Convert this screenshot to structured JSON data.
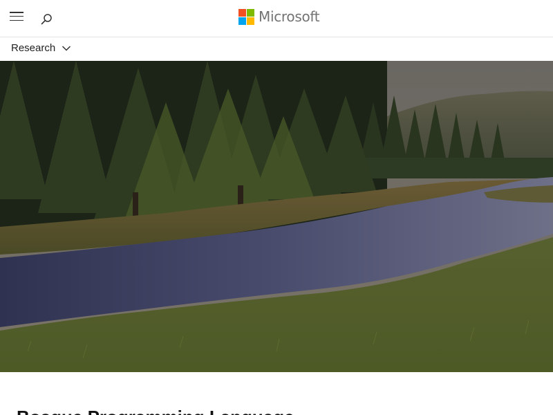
{
  "header": {
    "brand_name": "Microsoft",
    "logo_colors": [
      "#f25022",
      "#7fba00",
      "#00a4ef",
      "#ffb900"
    ],
    "menu_icon": "hamburger-menu-icon",
    "search_icon": "search-icon"
  },
  "subnav": {
    "section_label": "Research",
    "chevron_icon": "chevron-down-icon"
  },
  "main": {
    "page_title": "Bosque Programming Language"
  }
}
